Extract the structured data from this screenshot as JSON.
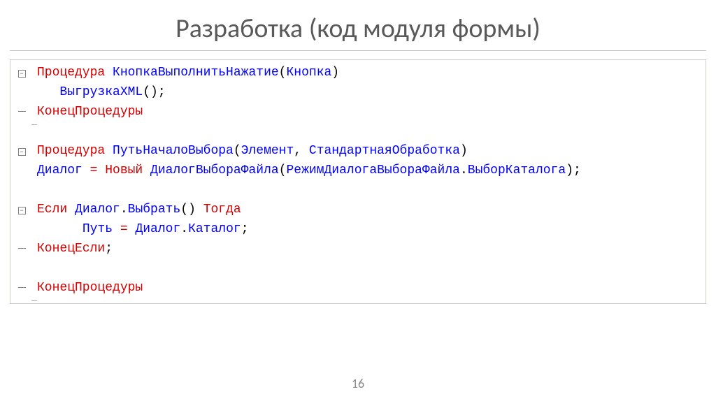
{
  "title": "Разработка (код модуля формы)",
  "page_number": "16",
  "code": {
    "l1": {
      "kw": "Процедура",
      "name": "КнопкаВыполнитьНажатие",
      "p1": "(",
      "arg": "Кнопка",
      "p2": ")"
    },
    "l2": {
      "call": "ВыгрузкаXML",
      "p": "();"
    },
    "l3": {
      "kw": "КонецПроцедуры"
    },
    "l4": {
      "kw": "Процедура",
      "name": "ПутьНачалоВыбора",
      "p1": "(",
      "a1": "Элемент",
      "c": ", ",
      "a2": "СтандартнаяОбработка",
      "p2": ")"
    },
    "l5": {
      "v1": "Диалог",
      "eq": " = ",
      "kw": "Новый",
      "sp": " ",
      "fn": "ДиалогВыбораФайла",
      "p1": "(",
      "a": "РежимДиалогаВыбораФайла",
      "dot": ".",
      "m": "ВыборКаталога",
      "p2": ");"
    },
    "l6": {
      "kw1": "Если",
      "sp1": " ",
      "v": "Диалог",
      "dot": ".",
      "m": "Выбрать",
      "p": "()",
      "sp2": " ",
      "kw2": "Тогда"
    },
    "l7": {
      "v1": "Путь",
      "eq": " = ",
      "v2": "Диалог",
      "dot": ".",
      "m": "Каталог",
      "sc": ";"
    },
    "l8": {
      "kw": "КонецЕсли",
      "sc": ";"
    },
    "l9": {
      "kw": "КонецПроцедуры"
    }
  }
}
